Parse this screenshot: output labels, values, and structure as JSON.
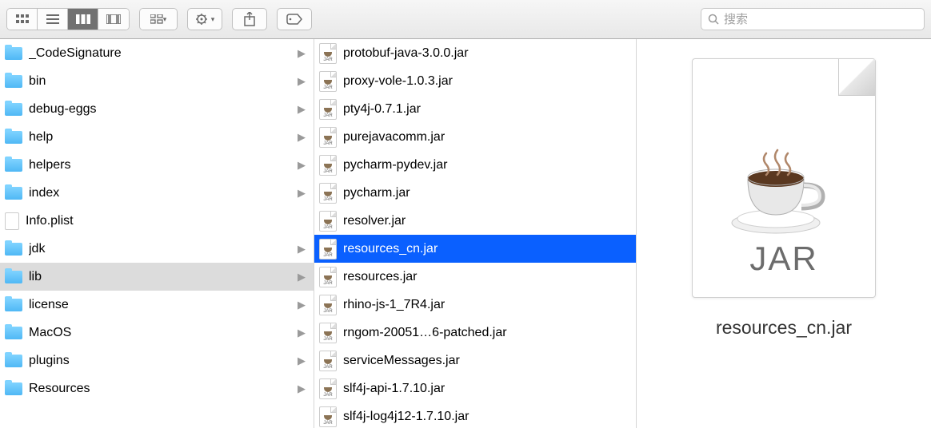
{
  "search": {
    "placeholder": "搜索"
  },
  "leftColumn": {
    "items": [
      {
        "name": "_CodeSignature",
        "type": "folder",
        "hasChildren": true,
        "selected": false
      },
      {
        "name": "bin",
        "type": "folder",
        "hasChildren": true,
        "selected": false
      },
      {
        "name": "debug-eggs",
        "type": "folder",
        "hasChildren": true,
        "selected": false
      },
      {
        "name": "help",
        "type": "folder",
        "hasChildren": true,
        "selected": false
      },
      {
        "name": "helpers",
        "type": "folder",
        "hasChildren": true,
        "selected": false
      },
      {
        "name": "index",
        "type": "folder",
        "hasChildren": true,
        "selected": false
      },
      {
        "name": "Info.plist",
        "type": "file",
        "hasChildren": false,
        "selected": false
      },
      {
        "name": "jdk",
        "type": "folder",
        "hasChildren": true,
        "selected": false
      },
      {
        "name": "lib",
        "type": "folder",
        "hasChildren": true,
        "selected": true
      },
      {
        "name": "license",
        "type": "folder",
        "hasChildren": true,
        "selected": false
      },
      {
        "name": "MacOS",
        "type": "folder",
        "hasChildren": true,
        "selected": false
      },
      {
        "name": "plugins",
        "type": "folder",
        "hasChildren": true,
        "selected": false
      },
      {
        "name": "Resources",
        "type": "folder",
        "hasChildren": true,
        "selected": false
      }
    ]
  },
  "midColumn": {
    "items": [
      {
        "name": "protobuf-java-3.0.0.jar",
        "selected": false
      },
      {
        "name": "proxy-vole-1.0.3.jar",
        "selected": false
      },
      {
        "name": "pty4j-0.7.1.jar",
        "selected": false
      },
      {
        "name": "purejavacomm.jar",
        "selected": false
      },
      {
        "name": "pycharm-pydev.jar",
        "selected": false
      },
      {
        "name": "pycharm.jar",
        "selected": false
      },
      {
        "name": "resolver.jar",
        "selected": false
      },
      {
        "name": "resources_cn.jar",
        "selected": true
      },
      {
        "name": "resources.jar",
        "selected": false
      },
      {
        "name": "rhino-js-1_7R4.jar",
        "selected": false
      },
      {
        "name": "rngom-20051…6-patched.jar",
        "selected": false
      },
      {
        "name": "serviceMessages.jar",
        "selected": false
      },
      {
        "name": "slf4j-api-1.7.10.jar",
        "selected": false
      },
      {
        "name": "slf4j-log4j12-1.7.10.jar",
        "selected": false
      }
    ]
  },
  "preview": {
    "fileName": "resources_cn.jar",
    "typeLabel": "JAR"
  }
}
